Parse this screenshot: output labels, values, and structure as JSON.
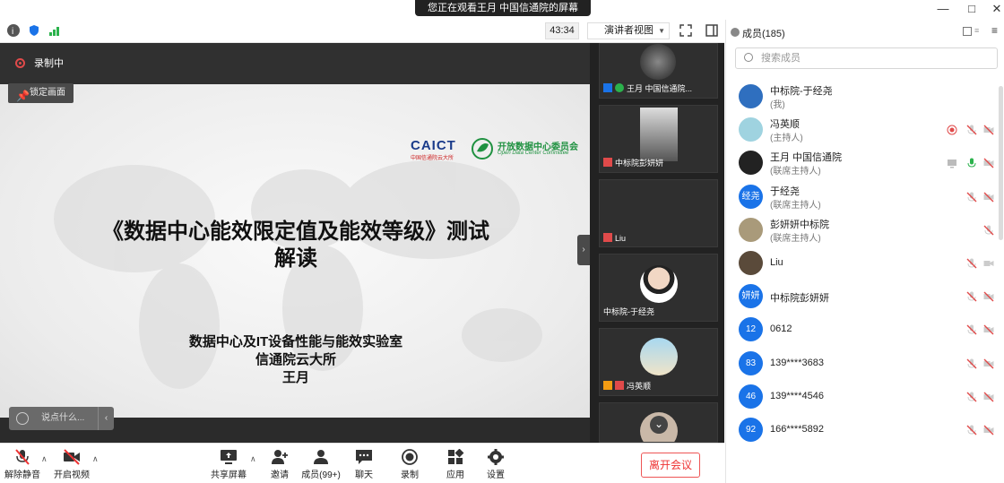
{
  "window": {
    "share_banner": "您正在观看王月  中国信通院的屏幕",
    "controls": [
      "—",
      "□",
      "✕"
    ]
  },
  "topbar": {
    "timer": "43:34",
    "view_mode": "演讲者视图"
  },
  "stage": {
    "recording_label": "录制中",
    "lock_button": "锁定画面",
    "chat_placeholder": "说点什么...",
    "chat_arrow": "‹",
    "handle_arrow": "›",
    "logo_caict": "CAICT",
    "logo_caict_sub": "中国信通院云大所",
    "logo_odcc": "开放数据中心委员会",
    "logo_odcc_sub": "Open Data Center Committee",
    "title_line1": "《数据中心能效限定值及能效等级》测试",
    "title_line2": "解读",
    "subtitle_line1": "数据中心及IT设备性能与能效实验室",
    "subtitle_line2": "信通院云大所",
    "subtitle_line3": "王月"
  },
  "strip": {
    "tiles": [
      {
        "name": "王月  中国信通院..."
      },
      {
        "name": "中标院彭妍妍"
      },
      {
        "name": "Liu"
      },
      {
        "name": "中标院-于经尧"
      },
      {
        "name": "冯英顺"
      }
    ],
    "more_arrow": "⌄"
  },
  "bottombar": {
    "unmute": "解除静音",
    "video": "开启视频",
    "share": "共享屏幕",
    "invite": "邀请",
    "members": "成员(99+)",
    "chat": "聊天",
    "record": "录制",
    "apps": "应用",
    "settings": "设置",
    "leave": "离开会议"
  },
  "panel": {
    "title": "成员(185)",
    "search_placeholder": "搜索成员",
    "members": [
      {
        "name": "中标院-于经尧",
        "role": "(我)",
        "avatar": ""
      },
      {
        "name": "冯英顺",
        "role": "(主持人)",
        "avatar": ""
      },
      {
        "name": "王月  中国信通院",
        "role": "(联席主持人)",
        "avatar": ""
      },
      {
        "name": "于经尧",
        "role": "(联席主持人)",
        "avatar": "经尧"
      },
      {
        "name": "彭妍妍中标院",
        "role": "(联席主持人)",
        "avatar": ""
      },
      {
        "name": "Liu",
        "role": "",
        "avatar": ""
      },
      {
        "name": "中标院彭妍妍",
        "role": "",
        "avatar": "妍妍"
      },
      {
        "name": "0612",
        "role": "",
        "avatar": "12"
      },
      {
        "name": "139****3683",
        "role": "",
        "avatar": "83"
      },
      {
        "name": "139****4546",
        "role": "",
        "avatar": "46"
      },
      {
        "name": "166****5892",
        "role": "",
        "avatar": "92"
      }
    ]
  },
  "colors": {
    "accent_blue": "#1a73e8",
    "record_red": "#e04a4a",
    "mic_green": "#2bb24c",
    "leave_red": "#e33333"
  }
}
